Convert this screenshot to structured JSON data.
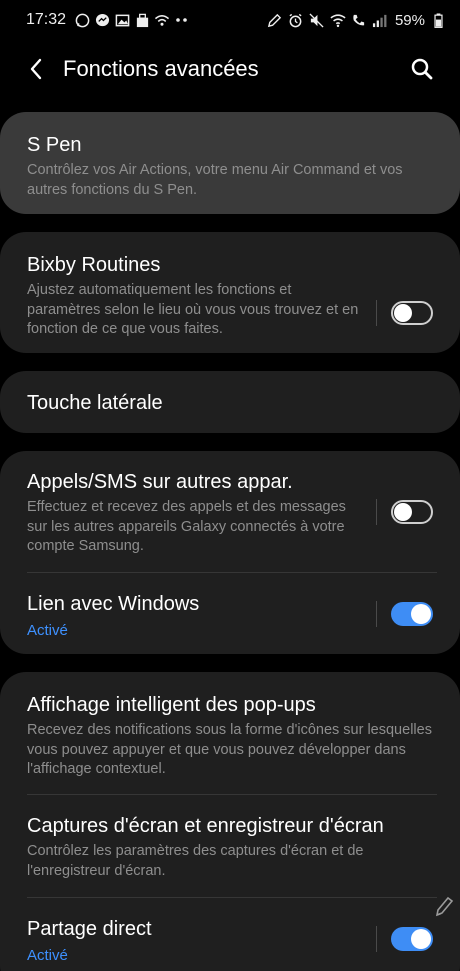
{
  "status_bar": {
    "time": "17:32",
    "battery": "59%"
  },
  "header": {
    "title": "Fonctions avancées"
  },
  "items": {
    "s_pen": {
      "title": "S Pen",
      "desc": "Contrôlez vos Air Actions, votre menu Air Command et vos autres fonctions du S Pen."
    },
    "bixby": {
      "title": "Bixby Routines",
      "desc": "Ajustez automatiquement les fonctions et paramètres selon le lieu où vous vous trouvez et en fonction de ce que vous faites.",
      "enabled": false
    },
    "side_key": {
      "title": "Touche latérale"
    },
    "calls_sms": {
      "title": "Appels/SMS sur autres appar.",
      "desc": "Effectuez et recevez des appels et des messages sur les autres appareils Galaxy connectés à votre compte Samsung.",
      "enabled": false
    },
    "link_windows": {
      "title": "Lien avec Windows",
      "status": "Activé",
      "enabled": true
    },
    "smart_popup": {
      "title": "Affichage intelligent des pop-ups",
      "desc": "Recevez des notifications sous la forme d'icônes sur lesquelles vous pouvez appuyer et que vous pouvez développer dans l'affichage contextuel."
    },
    "screenshots": {
      "title": "Captures d'écran et enregistreur d'écran",
      "desc": "Contrôlez les paramètres des captures d'écran et de l'enregistreur d'écran."
    },
    "direct_share": {
      "title": "Partage direct",
      "status": "Activé",
      "enabled": true
    }
  },
  "colors": {
    "accent": "#3e8df5",
    "card_bg": "#1f1f1f",
    "card_highlight": "#3a3a3a",
    "status_text": "#3e91ff"
  }
}
